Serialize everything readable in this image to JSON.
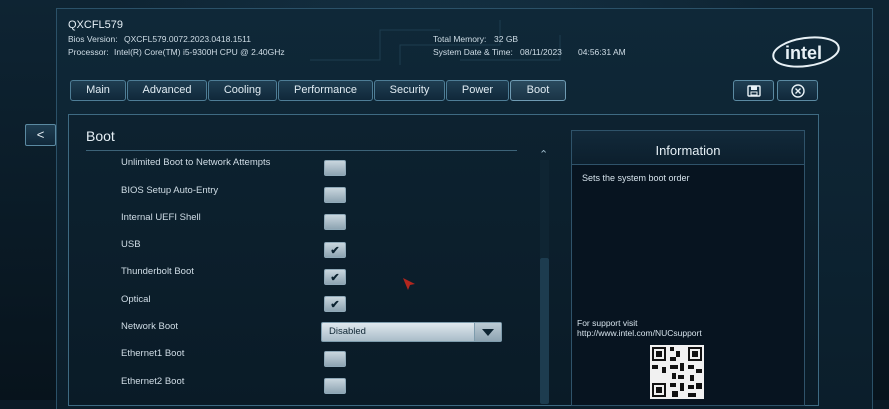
{
  "header": {
    "model": "QXCFL579",
    "bios_label": "Bios Version:",
    "bios_value": "QXCFL579.0072.2023.0418.1511",
    "processor_label": "Processor:",
    "processor_value": "Intel(R) Core(TM) i5-9300H CPU @ 2.40GHz",
    "memory_label": "Total Memory:",
    "memory_value": "32 GB",
    "datetime_label": "System Date & Time:",
    "date_value": "08/11/2023",
    "time_value": "04:56:31 AM"
  },
  "tabs": [
    "Main",
    "Advanced",
    "Cooling",
    "Performance",
    "Security",
    "Power",
    "Boot"
  ],
  "active_tab": "Boot",
  "back_label": "<",
  "section_title": "Boot",
  "rows": [
    {
      "label": "Unlimited Boot to Network Attempts",
      "checked": false
    },
    {
      "label": "BIOS Setup Auto-Entry",
      "checked": false
    },
    {
      "label": "Internal UEFI Shell",
      "checked": false
    },
    {
      "label": "USB",
      "checked": true
    },
    {
      "label": "Thunderbolt Boot",
      "checked": true
    },
    {
      "label": "Optical",
      "checked": true
    },
    {
      "label": "Network Boot",
      "select": "Disabled"
    },
    {
      "label": "Ethernet1 Boot",
      "checked": false
    },
    {
      "label": "Ethernet2 Boot",
      "checked": false
    }
  ],
  "info": {
    "title": "Information",
    "description": "Sets the system boot order",
    "support_line1": "For support visit",
    "support_line2": "http://www.intel.com/NUCsupport"
  },
  "icons": {
    "save": "save-icon",
    "exit": "close-circle-icon",
    "logo": "intel-logo"
  },
  "colors": {
    "background": "#0a1a26",
    "tab_border": "#4e7d96",
    "text": "#d6e3ec"
  }
}
